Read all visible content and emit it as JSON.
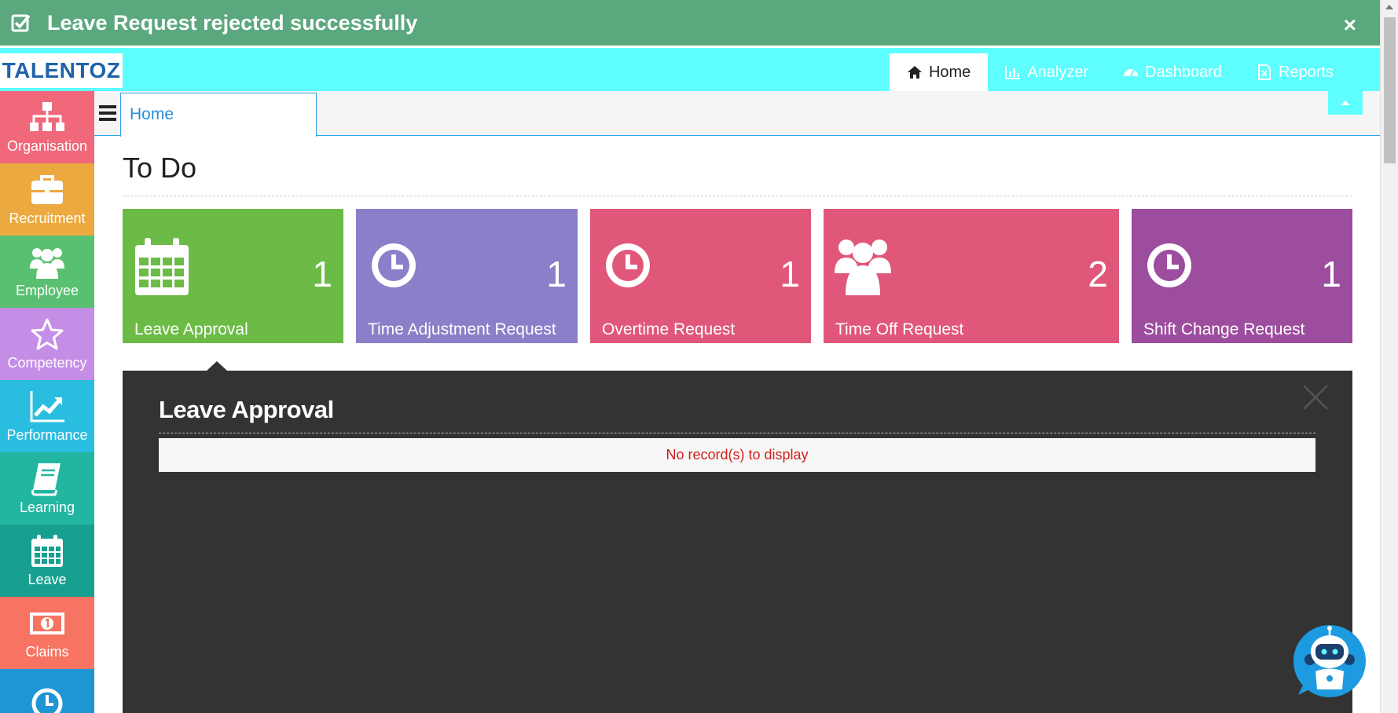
{
  "notification": {
    "message": "Leave Request rejected successfully",
    "close": "×"
  },
  "brand": {
    "logo_text": "TALENTOZ"
  },
  "nav": [
    {
      "label": "Home",
      "icon": "home-icon",
      "active": true
    },
    {
      "label": "Analyzer",
      "icon": "bar-chart-icon"
    },
    {
      "label": "Dashboard",
      "icon": "dashboard-icon"
    },
    {
      "label": "Reports",
      "icon": "excel-file-icon"
    }
  ],
  "sidebar": [
    {
      "label": "Organisation",
      "icon": "org-chart-icon",
      "color": "#f0687a"
    },
    {
      "label": "Recruitment",
      "icon": "briefcase-icon",
      "color": "#eba93f"
    },
    {
      "label": "Employee",
      "icon": "users-icon",
      "color": "#58c070"
    },
    {
      "label": "Competency",
      "icon": "star-icon",
      "color": "#c58ee6"
    },
    {
      "label": "Performance",
      "icon": "trend-chart-icon",
      "color": "#29bee0"
    },
    {
      "label": "Learning",
      "icon": "book-icon",
      "color": "#22b6a0"
    },
    {
      "label": "Leave",
      "icon": "calendar-icon",
      "color": "#17a08f"
    },
    {
      "label": "Claims",
      "icon": "money-icon",
      "color": "#f77362"
    },
    {
      "label": "",
      "icon": "clock-icon",
      "color": "#1f95d3"
    }
  ],
  "tabs": {
    "active": "Home"
  },
  "page": {
    "title": "To Do"
  },
  "cards": [
    {
      "label": "Leave Approval",
      "count": "1",
      "icon": "calendar-icon",
      "color": "#6dbb47"
    },
    {
      "label": "Time Adjustment Request",
      "count": "1",
      "icon": "clock-icon",
      "color": "#8a7fc8"
    },
    {
      "label": "Overtime Request",
      "count": "1",
      "icon": "clock-icon",
      "color": "#e0577a"
    },
    {
      "label": "Time Off Request",
      "count": "2",
      "icon": "users-icon",
      "color": "#e0577a"
    },
    {
      "label": "Shift Change Request",
      "count": "1",
      "icon": "clock-icon",
      "color": "#9c4d9e"
    }
  ],
  "panel": {
    "title": "Leave Approval",
    "empty_message": "No record(s) to display"
  },
  "colors": {
    "topbar": "#5efefe",
    "notification": "#5ba87e",
    "panel": "#333333",
    "accent": "#2a8fd8"
  }
}
